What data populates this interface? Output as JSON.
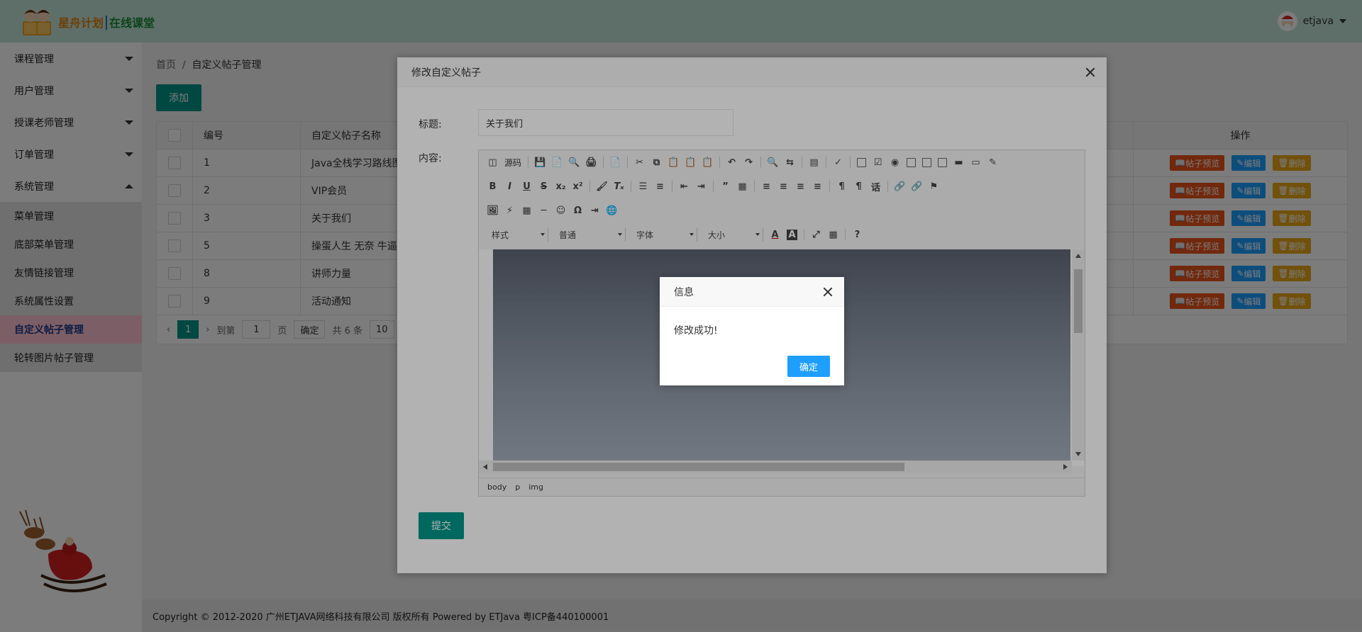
{
  "header": {
    "brand_part1": "星舟计划",
    "brand_part2": "在线课堂",
    "username": "etjava"
  },
  "sidebar": {
    "items": [
      {
        "label": "课程管理"
      },
      {
        "label": "用户管理"
      },
      {
        "label": "授课老师管理"
      },
      {
        "label": "订单管理"
      },
      {
        "label": "系统管理"
      }
    ],
    "sub_items": [
      {
        "label": "菜单管理"
      },
      {
        "label": "底部菜单管理"
      },
      {
        "label": "友情链接管理"
      },
      {
        "label": "系统属性设置"
      },
      {
        "label": "自定义帖子管理"
      },
      {
        "label": "轮转图片帖子管理"
      }
    ]
  },
  "breadcrumb": {
    "home": "首页",
    "separator": "/",
    "current": "自定义帖子管理"
  },
  "toolbar": {
    "add_label": "添加"
  },
  "table": {
    "columns": {
      "id": "编号",
      "name": "自定义帖子名称",
      "ops": "操作"
    },
    "rows": [
      {
        "id": "1",
        "name": "Java全栈学习路线图"
      },
      {
        "id": "2",
        "name": "VIP会员"
      },
      {
        "id": "3",
        "name": "关于我们"
      },
      {
        "id": "5",
        "name": "操蛋人生 无奈 牛逼plus"
      },
      {
        "id": "8",
        "name": "讲师力量"
      },
      {
        "id": "9",
        "name": "活动通知"
      }
    ],
    "ops": {
      "preview": "帖子预览",
      "edit": "编辑",
      "delete": "删除"
    }
  },
  "pager": {
    "current": "1",
    "goto_label": "到第",
    "goto_value": "1",
    "page_unit": "页",
    "confirm": "确定",
    "total": "共 6 条",
    "per_page": "10"
  },
  "footer": {
    "text": "Copyright © 2012-2020 广州ETJAVA网络科技有限公司 版权所有 Powered by ETJava 粤ICP备440100001"
  },
  "modal": {
    "title": "修改自定义帖子",
    "title_label": "标题:",
    "title_value": "关于我们",
    "content_label": "内容:",
    "source_label": "源码",
    "style_label": "样式",
    "format_label": "普通",
    "font_label": "字体",
    "size_label": "大小",
    "path": [
      "body",
      "p",
      "img"
    ],
    "submit_label": "提交"
  },
  "dialog": {
    "title": "信息",
    "message": "修改成功!",
    "ok_label": "确定"
  },
  "colors": {
    "header_bg": "#c2e4d8",
    "primary": "#009688",
    "active_menu": "#ffc3d2",
    "preview_btn": "#e8531a",
    "edit_btn": "#1e9fff",
    "delete_btn": "#e8a817"
  }
}
